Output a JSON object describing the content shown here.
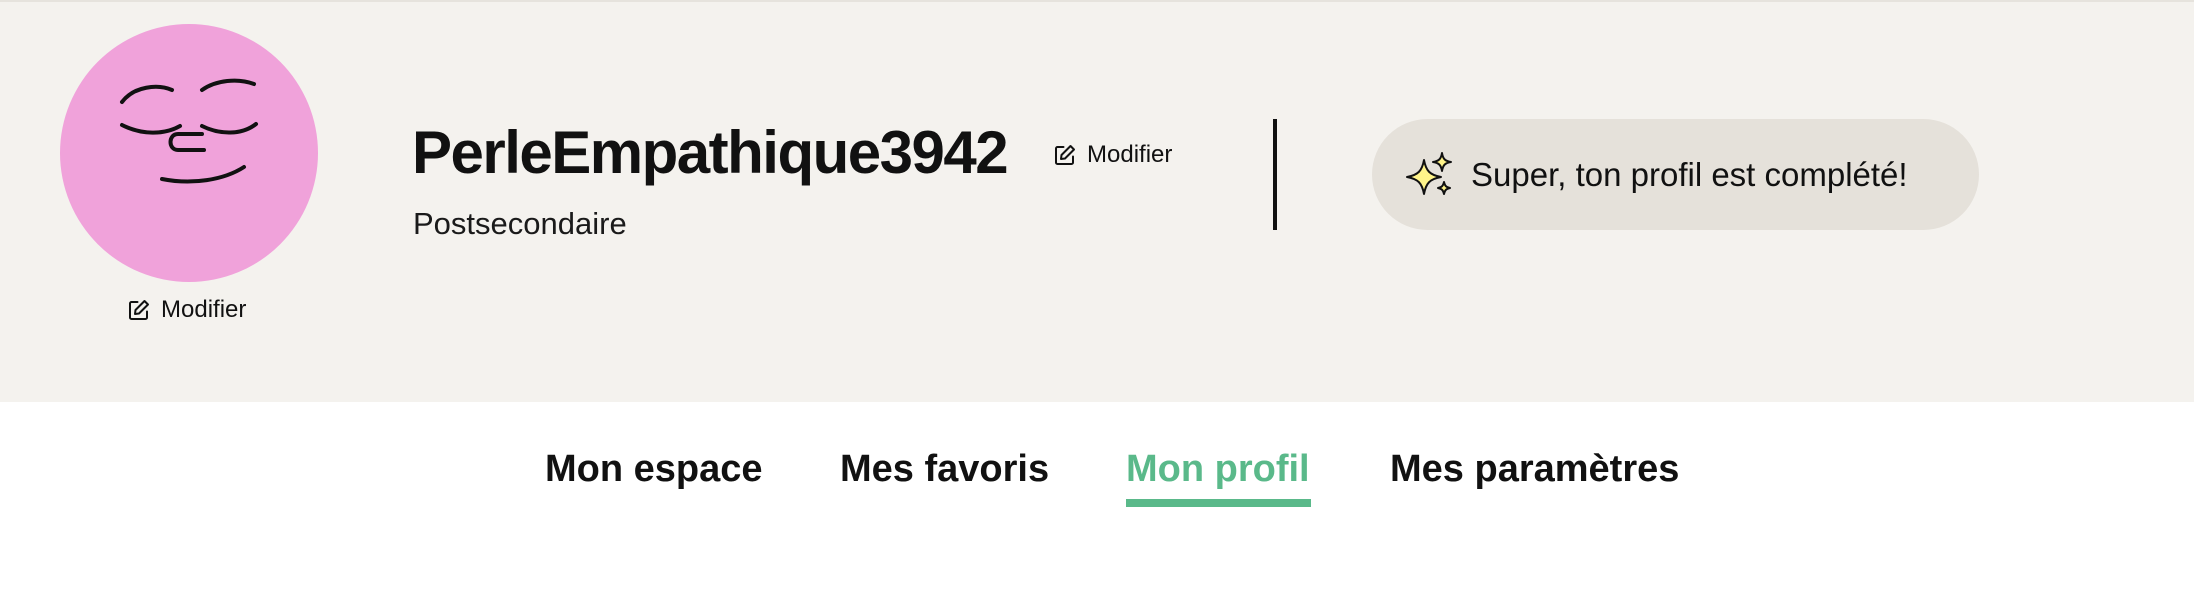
{
  "header": {
    "avatar": {
      "icon": "sleepy-face-icon",
      "color": "#f0a2da"
    },
    "avatar_edit_label": "Modifier",
    "username": "PerleEmpathique3942",
    "username_edit_label": "Modifier",
    "level": "Postsecondaire",
    "profile_status": {
      "icon": "sparkles-icon",
      "text": "Super, ton profil est complété!"
    },
    "background_color": "#f4f2ee"
  },
  "tabs": {
    "items": [
      {
        "label": "Mon espace",
        "active": false
      },
      {
        "label": "Mes favoris",
        "active": false
      },
      {
        "label": "Mon profil",
        "active": true
      },
      {
        "label": "Mes paramètres",
        "active": false
      }
    ],
    "active_color": "#5ab98a"
  }
}
